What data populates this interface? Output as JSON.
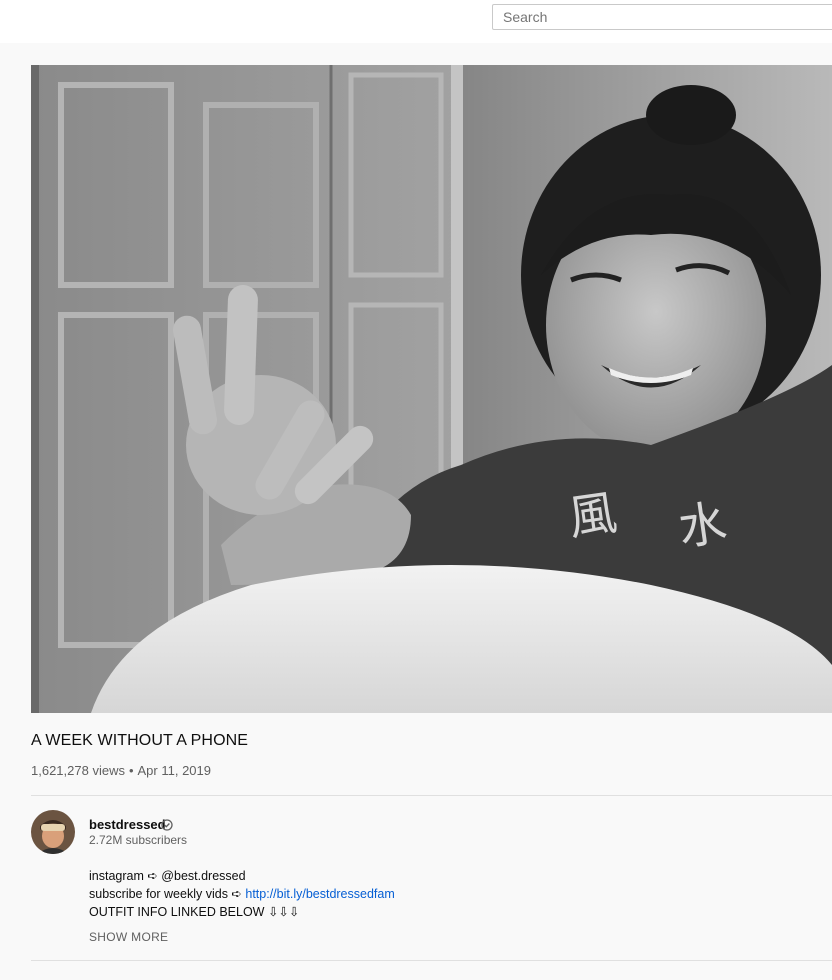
{
  "search": {
    "placeholder": "Search"
  },
  "video": {
    "title": "A WEEK WITHOUT A PHONE",
    "views": "1,621,278 views",
    "separator": "•",
    "date": "Apr 11, 2019"
  },
  "channel": {
    "name": "bestdressed",
    "subscribers": "2.72M subscribers",
    "verified_icon": "verified-check-icon"
  },
  "description": {
    "line1": "instagram ➪ @best.dressed",
    "line2_prefix": "subscribe for weekly vids ➪ ",
    "line2_link": "http://bit.ly/bestdressedfam",
    "line3": "OUTFIT INFO LINKED BELOW ⇩⇩⇩",
    "show_more": "SHOW MORE"
  },
  "colors": {
    "link": "#065fd4",
    "secondary_text": "#606060",
    "background": "#f9f9f9"
  }
}
